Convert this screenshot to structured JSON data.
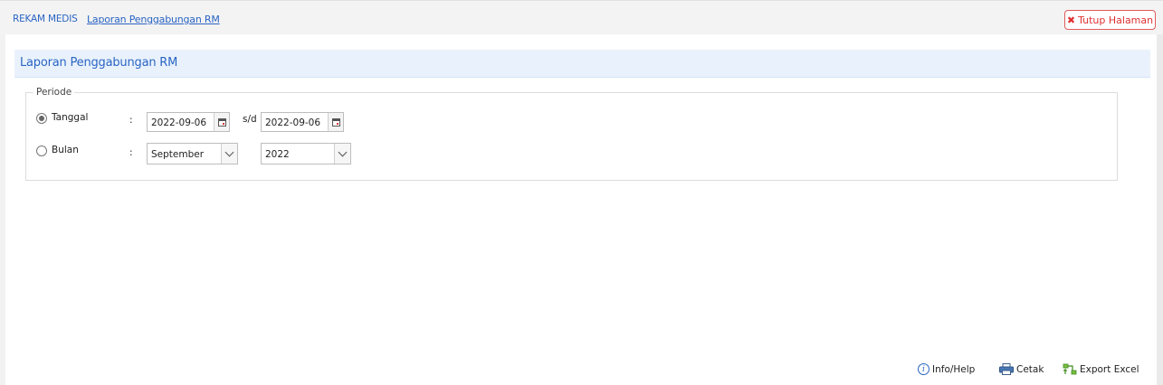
{
  "breadcrumb": {
    "root": "REKAM MEDIS",
    "current": "Laporan Penggabungan RM"
  },
  "close_button": {
    "label": "Tutup Halaman",
    "icon": "close-icon",
    "color": "#e03131"
  },
  "panel": {
    "title": "Laporan Penggabungan RM"
  },
  "periode": {
    "legend": "Periode",
    "tanggal": {
      "label": "Tanggal",
      "selected": true,
      "colon": ":",
      "from": "2022-09-06",
      "separator": "s/d",
      "to": "2022-09-06"
    },
    "bulan": {
      "label": "Bulan",
      "selected": false,
      "colon": ":",
      "month": "September",
      "year": "2022"
    }
  },
  "footer": {
    "info": "Info/Help",
    "print": "Cetak",
    "export": "Export Excel"
  },
  "colors": {
    "accent": "#2a65c4",
    "header_bg": "#e9f2fc"
  }
}
